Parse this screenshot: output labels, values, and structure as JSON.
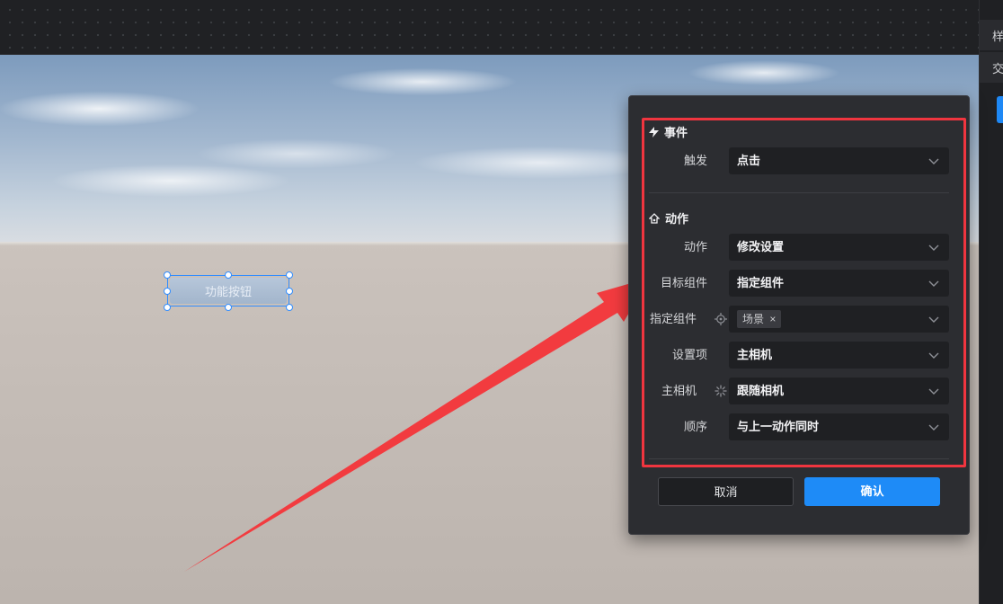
{
  "right_panel": {
    "tabs": [
      "样式",
      "交互"
    ]
  },
  "canvas": {
    "function_button_label": "功能按钮"
  },
  "modal": {
    "event_section": {
      "title": "事件",
      "trigger_label": "触发",
      "trigger_value": "点击"
    },
    "action_section": {
      "title": "动作",
      "rows": {
        "action": {
          "label": "动作",
          "value": "修改设置"
        },
        "target": {
          "label": "目标组件",
          "value": "指定组件"
        },
        "specified": {
          "label": "指定组件",
          "tag": "场景"
        },
        "setting": {
          "label": "设置项",
          "value": "主相机"
        },
        "camera": {
          "label": "主相机",
          "value": "跟随相机"
        },
        "order": {
          "label": "顺序",
          "value": "与上一动作同时"
        }
      }
    },
    "buttons": {
      "cancel": "取消",
      "confirm": "确认"
    }
  },
  "colors": {
    "accent": "#1e8bf7",
    "highlight": "#f0353f",
    "panel_bg": "#2c2d31"
  }
}
